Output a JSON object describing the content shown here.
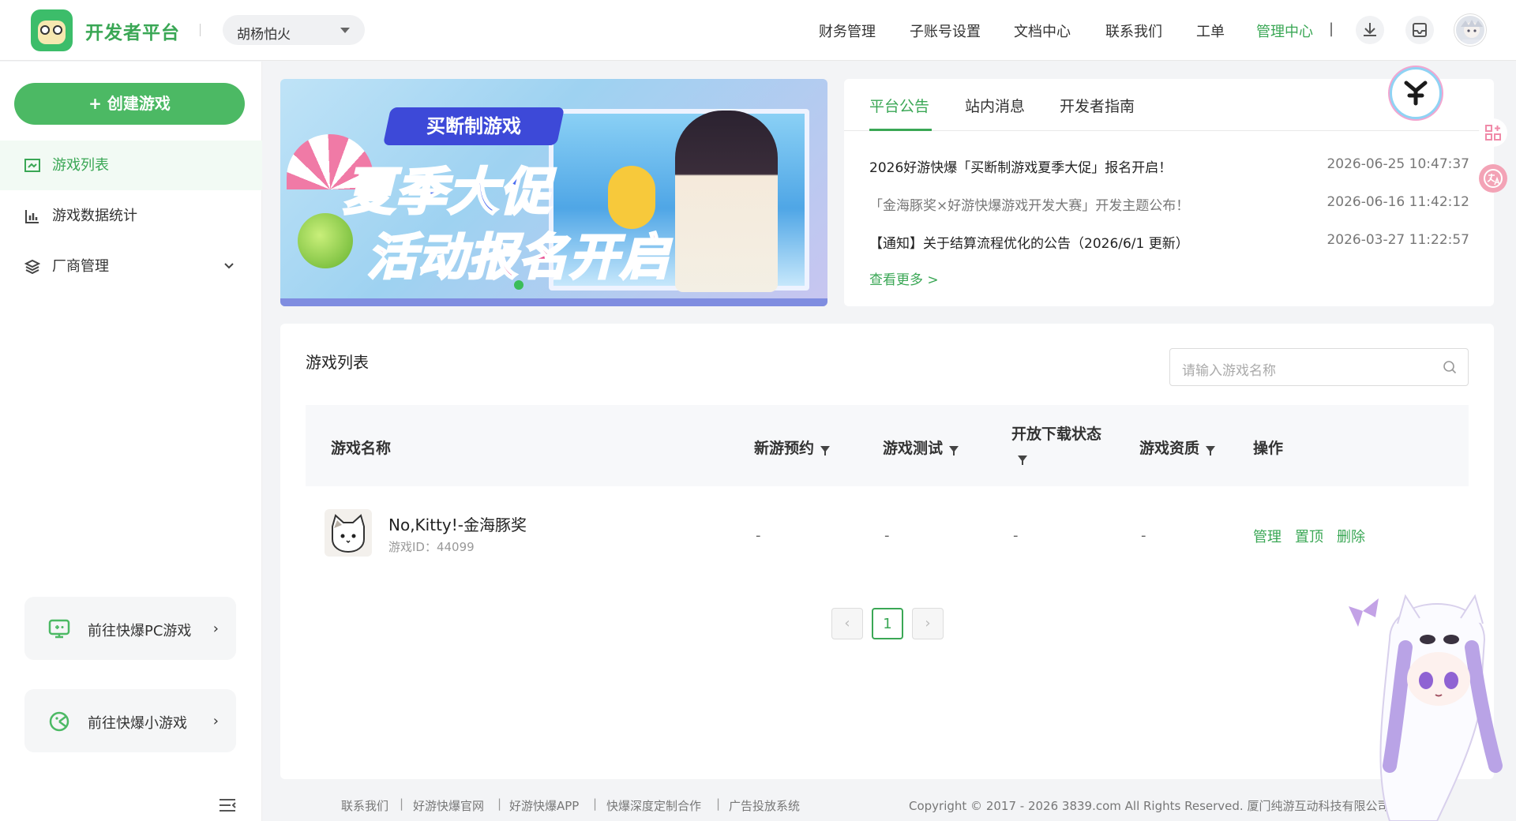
{
  "header": {
    "brand": "开发者平台",
    "account": "胡杨怕火",
    "nav": [
      "财务管理",
      "子账号设置",
      "文档中心",
      "联系我们",
      "工单",
      "管理中心"
    ],
    "nav_separator": "|",
    "icons": [
      "download-icon",
      "inbox-icon",
      "user-avatar"
    ]
  },
  "sidebar": {
    "create_label": "+ 创建游戏",
    "items": [
      {
        "label": "游戏列表",
        "icon": "game-list-icon",
        "active": true
      },
      {
        "label": "游戏数据统计",
        "icon": "bar-chart-icon"
      },
      {
        "label": "厂商管理",
        "icon": "layers-icon",
        "expandable": true
      }
    ],
    "goto_pc": "前往快爆PC游戏",
    "goto_mini": "前往快爆小游戏"
  },
  "banner": {
    "tag": "买断制游戏",
    "line1": "夏季大促",
    "line2": "活动报名开启"
  },
  "notice": {
    "tabs": [
      "平台公告",
      "站内消息",
      "开发者指南"
    ],
    "rows": [
      {
        "text": "2026好游快爆「买断制游戏夏季大促」报名开启！",
        "date": "2026-06-25 10:47:37"
      },
      {
        "text": "「金海豚奖×好游快爆游戏开发大赛」开发主题公布！",
        "date": "2026-06-16 11:42:12"
      },
      {
        "text": "【通知】关于结算流程优化的公告（2026/6/1 更新）",
        "date": "2026-03-27 11:22:57"
      }
    ],
    "more": "查看更多 >"
  },
  "main": {
    "title": "游戏列表",
    "search_placeholder": "请输入游戏名称",
    "columns": [
      "游戏名称",
      "新游预约",
      "游戏测试",
      "开放下载状态",
      "游戏资质",
      "操作"
    ],
    "rows": [
      {
        "name": "No,Kitty!-金海豚奖",
        "id_label": "游戏ID：44099",
        "reserve": "-",
        "test": "-",
        "download": "-",
        "qualification": "-",
        "ops": [
          "管理",
          "置顶",
          "删除"
        ]
      }
    ],
    "pager": {
      "prev": "‹",
      "current": "1",
      "next": "›"
    }
  },
  "footer": {
    "links": [
      "联系我们",
      "好游快爆官网",
      "好游快爆APP",
      "快爆深度定制合作",
      "广告投放系统"
    ],
    "separator": "|",
    "copyright": "Copyright © 2017 - 2026 3839.com All Rights Reserved. 厦门纯游互动科技有限公司"
  },
  "colors": {
    "accent": "#3aa755",
    "button": "#4cb964"
  }
}
